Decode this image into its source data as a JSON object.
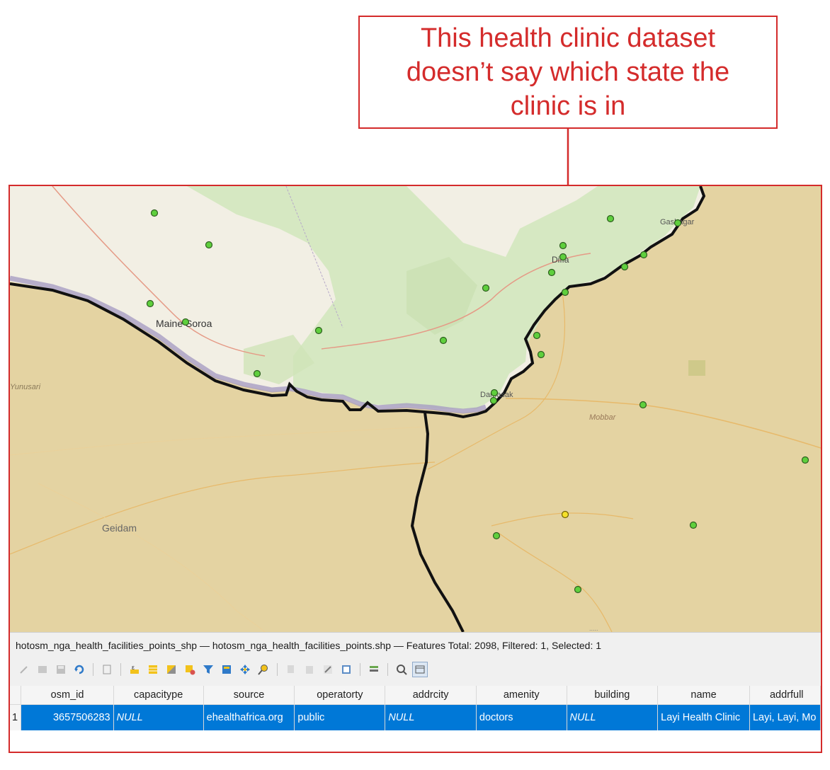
{
  "callout": {
    "text": "This health clinic dataset doesn’t say which state the clinic is in"
  },
  "colors": {
    "accent": "#d42b2b",
    "selection": "#0078d7",
    "point": "#5fcf3d",
    "selected_point": "#f5e02a"
  },
  "map": {
    "labels": {
      "maine_soroa": "Maine Soroa",
      "diffa": "Diffa",
      "gashagar": "Gashagar",
      "damasak": "Damasak",
      "mobbar": "Mobbar",
      "geidam": "Geidam",
      "yunusari": "Yunusari"
    }
  },
  "attr_table": {
    "status": "hotosm_nga_health_facilities_points_shp — hotosm_nga_health_facilities_points.shp — Features Total: 2098, Filtered: 1, Selected: 1",
    "columns": [
      "osm_id",
      "capacitype",
      "source",
      "operatorty",
      "addrcity",
      "amenity",
      "building",
      "name",
      "addrfull"
    ],
    "rows": [
      {
        "row_num": "1",
        "osm_id": "3657506283",
        "capacitype": "NULL",
        "source": "ehealthafrica.org",
        "operatorty": "public",
        "addrcity": "NULL",
        "amenity": "doctors",
        "building": "NULL",
        "name": "Layi Health Clinic",
        "addrfull": "Layi, Layi, Mo"
      }
    ]
  }
}
